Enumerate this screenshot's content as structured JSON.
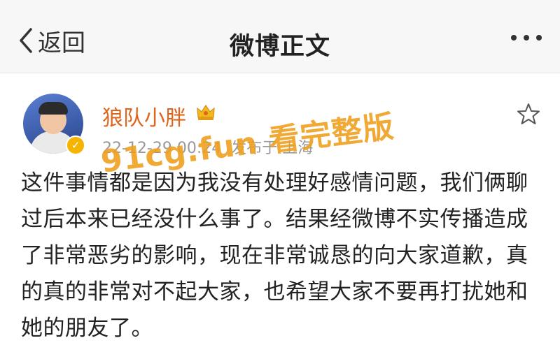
{
  "nav": {
    "back_label": "返回",
    "title": "微博正文"
  },
  "post": {
    "username": "狼队小胖",
    "timestamp": "22-12-29 00:24",
    "location": "发布于 上海",
    "content": "这件事情都是因为我没有处理好感情问题，我们俩聊过后本来已经没什么事了。结果经微博不实传播造成了非常恶劣的影响，现在非常诚恳的向大家道歉，真的真的非常对不起大家，也希望大家不要再打扰她和她的朋友了。"
  },
  "watermark": {
    "text": "91cg.fun 看完整版"
  },
  "colors": {
    "username": "#e0651a",
    "meta": "#999999",
    "watermark": "#f0a020",
    "nav_bg": "#f7f7f7"
  },
  "icons": [
    "chevron-left-icon",
    "more-icon",
    "star-icon",
    "crown-icon",
    "verified-icon"
  ]
}
